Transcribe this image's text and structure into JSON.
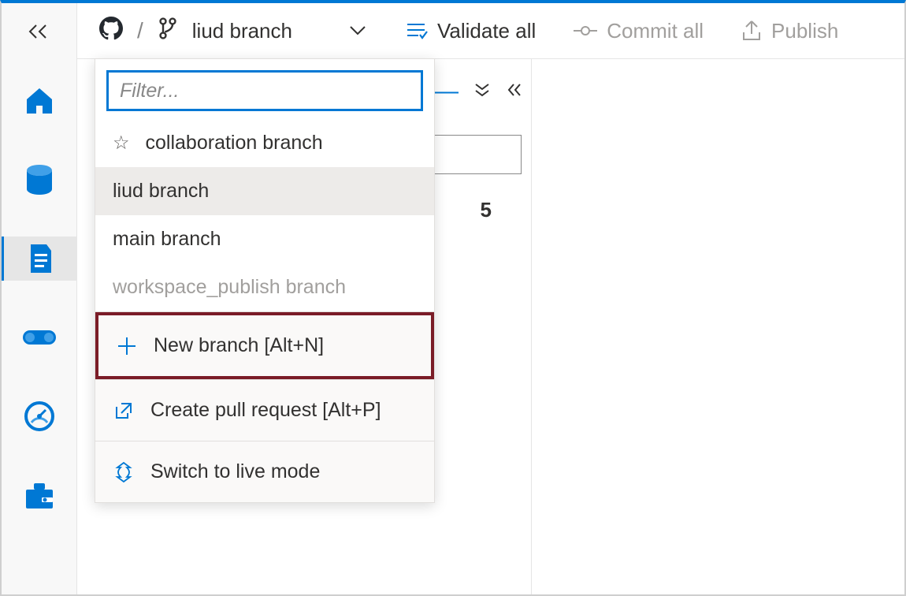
{
  "breadcrumb": {
    "slash": "/",
    "branch_label": "liud branch"
  },
  "toolbar": {
    "validate_all": "Validate all",
    "commit_all": "Commit all",
    "publish": "Publish"
  },
  "dropdown": {
    "filter_placeholder": "Filter...",
    "collab_label": "collaboration branch",
    "branches": {
      "selected": "liud branch",
      "main": "main branch",
      "workspace": "workspace_publish branch"
    },
    "actions": {
      "new_branch": "New branch [Alt+N]",
      "create_pr": "Create pull request [Alt+P]",
      "switch_live": "Switch to live mode"
    }
  },
  "panel": {
    "count": "5"
  }
}
